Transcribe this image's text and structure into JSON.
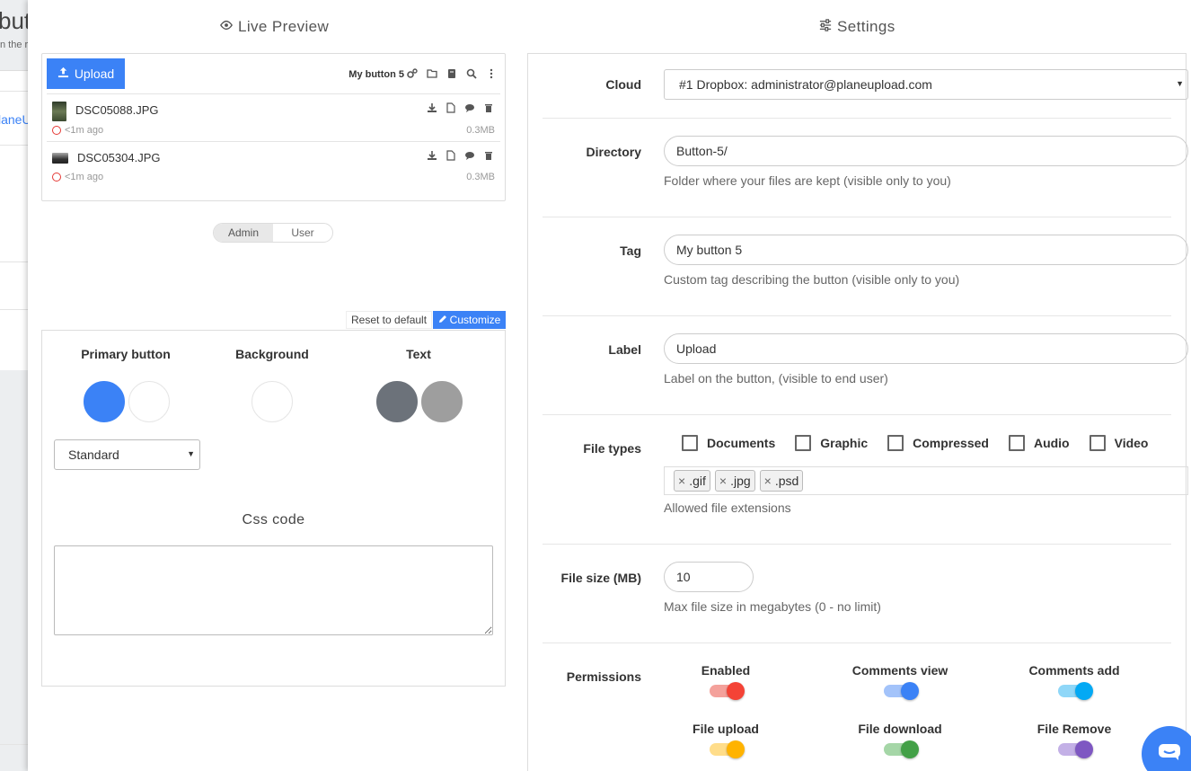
{
  "background_page": {
    "title_fragment": "butt",
    "subtitle_fragment": "n the r",
    "link_fragment": "laneU"
  },
  "preview": {
    "title": "Live Preview",
    "upload_label": "Upload",
    "button_tag": "My button 5",
    "toolbar_icons": [
      "settings-icon",
      "folder-icon",
      "stack-icon",
      "search-icon",
      "more-icon"
    ],
    "files": [
      {
        "name": "DSC05088.JPG",
        "time": "<1m ago",
        "size": "0.3MB"
      },
      {
        "name": "DSC05304.JPG",
        "time": "<1m ago",
        "size": "0.3MB"
      }
    ],
    "roles": [
      "Admin",
      "User"
    ],
    "active_role": "Admin"
  },
  "customize": {
    "reset_label": "Reset to default",
    "customize_label": "Customize",
    "primary_title": "Primary button",
    "background_title": "Background",
    "text_title": "Text",
    "colors": {
      "primary": "#3b82f6",
      "primary_alt": "#ffffff",
      "background": "#ffffff",
      "text": "#6c727a",
      "text_alt": "#9e9e9e"
    },
    "style_select": "Standard",
    "css_label": "Css code",
    "css_value": ""
  },
  "settings": {
    "title": "Settings",
    "cloud_label": "Cloud",
    "cloud_value": "#1 Dropbox: administrator@planeupload.com",
    "directory_label": "Directory",
    "directory_value": "Button-5/",
    "directory_help": "Folder where your files are kept (visible only to you)",
    "tag_label": "Tag",
    "tag_value": "My button 5",
    "tag_help": "Custom tag describing the button (visible only to you)",
    "label_label": "Label",
    "label_value": "Upload",
    "label_help": "Label on the button, (visible to end user)",
    "filetypes_label": "File types",
    "filetypes": [
      "Documents",
      "Graphic",
      "Compressed",
      "Audio",
      "Video"
    ],
    "extensions": [
      ".gif",
      ".jpg",
      ".psd"
    ],
    "extensions_help": "Allowed file extensions",
    "filesize_label": "File size (MB)",
    "filesize_value": "10",
    "filesize_help": "Max file size in megabytes (0 - no limit)",
    "permissions_label": "Permissions",
    "permissions": [
      {
        "label": "Enabled",
        "on": true,
        "color": "#f44336"
      },
      {
        "label": "Comments view",
        "on": true,
        "color": "#3b82f6"
      },
      {
        "label": "Comments add",
        "on": true,
        "color": "#03a9f4"
      },
      {
        "label": "File upload",
        "on": true,
        "color": "#ffb300"
      },
      {
        "label": "File download",
        "on": true,
        "color": "#43a047"
      },
      {
        "label": "File Remove",
        "on": true,
        "color": "#7e57c2"
      }
    ]
  }
}
